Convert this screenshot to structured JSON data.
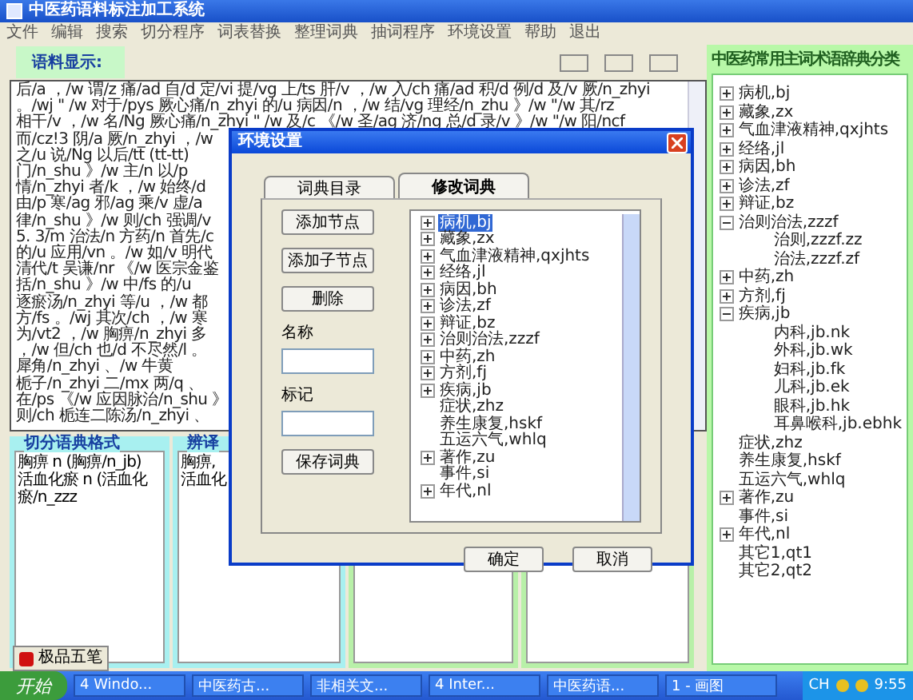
{
  "window": {
    "title": "中医药语料标注加工系统"
  },
  "menu": [
    "文件",
    "编辑",
    "搜索",
    "切分程序",
    "词表替换",
    "整理词典",
    "抽词程序",
    "环境设置",
    "帮助",
    "退出"
  ],
  "corpus": {
    "label": "语料显示:",
    "lines": [
      "后/a ，/w 谓/z 痛/ad 自/d 定/vi 提/vg 上/ts 肝/v ，/w 入/ch 痛/ad 积/d 例/d 及/v 厥/n_zhyi",
      "。/wj \" /w 对于/pys 厥心痛/n_zhyi 的/u 病因/n ，/w 结/vg 理经/n_zhu 》/w \"/w 其/rz",
      "相干/v ，/w 名/Ng 厥心痛/n_zhyi \" /w 及/c 《/w 圣/ag 济/ng 总/d 录/v 》/w \"/w 阳/ncf",
      "而/cz!3 阴/a 厥/n_zhyi ，/w",
      "之/u 说/Ng 以后/tt (tt-tt)",
      "门/n_shu 》/w 主/n 以/p",
      "情/n_zhyi 者/k ，/w 始终/d",
      "由/p 寒/ag 邪/ag 乘/v 虚/a",
      "律/n_shu 》/w 则/ch 强调/v",
      "5. 3/m 治法/n 方药/n 首先/c",
      "的/u 应用/vn 。/w 如/v 明代",
      "清代/t 吴谦/nr 《/w 医宗金鉴",
      "括/n_shu 》/w 中/fs 的/u",
      "逐瘀汤/n_zhyi 等/u ，/w 都",
      "方/fs 。/wj 其次/ch ，/w 寒",
      "为/vt2 ，/w 胸痹/n_zhyi 多",
      "，/w 但/ch 也/d 不尽然/l 。",
      "犀角/n_zhyi 、/w 牛黄",
      "栀子/n_zhyi 二/mx 两/q 、",
      "在/ps 《/w 应因脉治/n_shu 》",
      "则/ch 栀连二陈汤/n_zhyi 、"
    ]
  },
  "panes": [
    {
      "title": "切分语典格式",
      "color": "#a8f0f0",
      "lines": [
        "胸痹 n (胸痹/n_jb)",
        "活血化瘀 n (活血化瘀/n_zzz"
      ]
    },
    {
      "title": "辨译",
      "color": "#a8f0f0",
      "lines": [
        "胸痹,",
        "活血化"
      ]
    },
    {
      "color": "#b8f0a8"
    },
    {
      "color": "#b8f0a8"
    }
  ],
  "ime": {
    "label": "极品五笔"
  },
  "category_tree": {
    "title": "中医药常用主词术语辞典分类",
    "nodes": [
      {
        "label": "病机,bj",
        "expanded": false
      },
      {
        "label": "藏象,zx",
        "expanded": false
      },
      {
        "label": "气血津液精神,qxjhts",
        "expanded": false
      },
      {
        "label": "经络,jl",
        "expanded": false
      },
      {
        "label": "病因,bh",
        "expanded": false
      },
      {
        "label": "诊法,zf",
        "expanded": false
      },
      {
        "label": "辩证,bz",
        "expanded": false
      },
      {
        "label": "治则治法,zzzf",
        "expanded": true,
        "children": [
          {
            "label": "治则,zzzf.zz"
          },
          {
            "label": "治法,zzzf.zf"
          }
        ]
      },
      {
        "label": "中药,zh",
        "expanded": false
      },
      {
        "label": "方剂,fj",
        "expanded": false
      },
      {
        "label": "疾病,jb",
        "expanded": true,
        "children": [
          {
            "label": "内科,jb.nk"
          },
          {
            "label": "外科,jb.wk"
          },
          {
            "label": "妇科,jb.fk"
          },
          {
            "label": "儿科,jb.ek"
          },
          {
            "label": "眼科,jb.hk"
          },
          {
            "label": "耳鼻喉科,jb.ebhk"
          }
        ]
      },
      {
        "label": "症状,zhz"
      },
      {
        "label": "养生康复,hskf"
      },
      {
        "label": "五运六气,whlq"
      },
      {
        "label": "著作,zu",
        "expanded": false
      },
      {
        "label": "事件,si"
      },
      {
        "label": "年代,nl",
        "expanded": false
      },
      {
        "label": "其它1,qt1"
      },
      {
        "label": "其它2,qt2"
      }
    ]
  },
  "dialog": {
    "title": "环境设置",
    "tabs": [
      {
        "label": "词典目录",
        "selected": false
      },
      {
        "label": "修改词典",
        "selected": true
      }
    ],
    "actions": [
      "添加节点",
      "添加子节点",
      "删除"
    ],
    "fields": [
      {
        "label": "名称"
      },
      {
        "label": "标记"
      }
    ],
    "save": "保存词典",
    "tree": [
      {
        "label": "病机,bj",
        "expanded": false,
        "selected": true
      },
      {
        "label": "藏象,zx",
        "expanded": false,
        "selected": false
      },
      {
        "label": "气血津液精神,qxjhts",
        "expanded": false,
        "selected": false
      },
      {
        "label": "经络,jl",
        "expanded": false,
        "selected": false
      },
      {
        "label": "病因,bh",
        "expanded": false,
        "selected": false
      },
      {
        "label": "诊法,zf",
        "expanded": false,
        "selected": false
      },
      {
        "label": "辩证,bz",
        "expanded": false,
        "selected": false
      },
      {
        "label": "治则治法,zzzf",
        "expanded": false,
        "selected": false
      },
      {
        "label": "中药,zh",
        "expanded": false,
        "selected": false
      },
      {
        "label": "方剂,fj",
        "expanded": false,
        "selected": false
      },
      {
        "label": "疾病,jb",
        "expanded": false,
        "selected": false
      },
      {
        "label": "症状,zhz",
        "selected": false
      },
      {
        "label": "养生康复,hskf",
        "selected": false
      },
      {
        "label": "五运六气,whlq",
        "selected": false
      },
      {
        "label": "著作,zu",
        "expanded": false,
        "selected": false
      },
      {
        "label": "事件,si",
        "selected": false
      },
      {
        "label": "年代,nl",
        "expanded": false,
        "selected": false
      }
    ],
    "buttons": [
      "确定",
      "取消"
    ]
  },
  "taskbar": {
    "start": "开始",
    "tasks": [
      "4 Windo...",
      "中医药古...",
      "非相关文...",
      "4 Inter...",
      "中医药语...",
      "1 - 画图"
    ],
    "lang": "CH",
    "clock": "9:55"
  }
}
